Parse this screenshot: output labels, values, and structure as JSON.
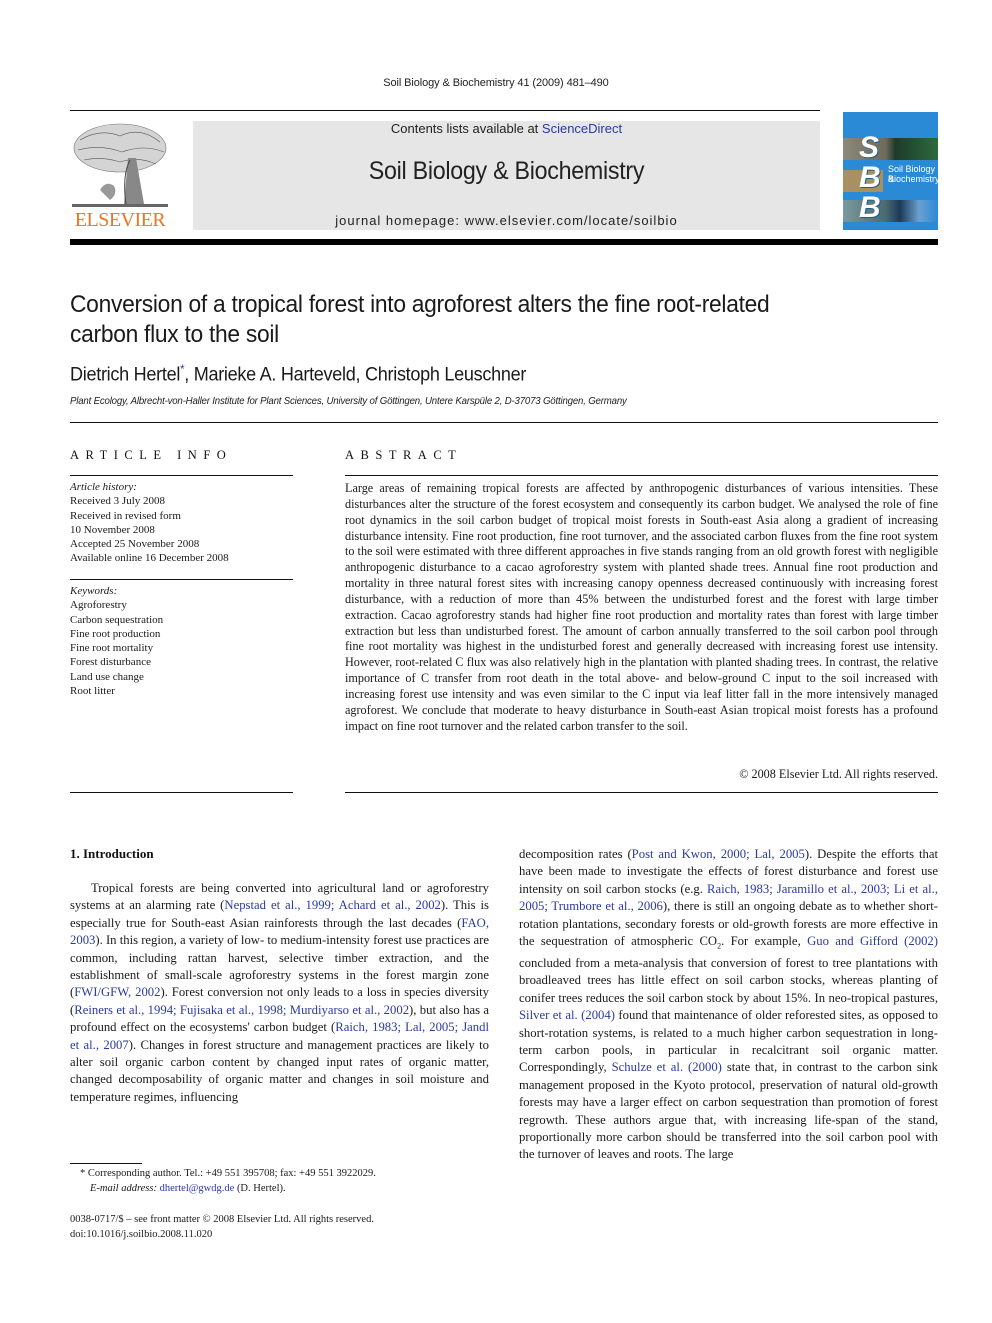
{
  "running_head": "Soil Biology & Biochemistry 41 (2009) 481–490",
  "masthead": {
    "contents_prefix": "Contents lists available at ",
    "contents_link": "ScienceDirect",
    "journal_title": "Soil Biology & Biochemistry",
    "homepage": "journal homepage: www.elsevier.com/locate/soilbio"
  },
  "publisher_logo": {
    "word": "ELSEVIER",
    "color": "#e87722"
  },
  "cover": {
    "letters": [
      "S",
      "B",
      "B"
    ],
    "text_line1": "Soil Biology &",
    "text_line2": "Biochemistry",
    "color": "#2a8ad6"
  },
  "article": {
    "title_line1": "Conversion of a tropical forest into agroforest alters the fine root-related",
    "title_line2": "carbon flux to the soil",
    "authors_first": "Dietrich Hertel",
    "authors_star": "*",
    "authors_rest": ", Marieke A. Harteveld, Christoph Leuschner",
    "affiliation": "Plant Ecology, Albrecht-von-Haller Institute for Plant Sciences, University of Göttingen, Untere Karspüle 2, D-37073 Göttingen, Germany"
  },
  "article_info": {
    "heading": "ARTICLE INFO",
    "history_label": "Article history:",
    "history": [
      "Received 3 July 2008",
      "Received in revised form",
      "10 November 2008",
      "Accepted 25 November 2008",
      "Available online 16 December 2008"
    ],
    "keywords_label": "Keywords:",
    "keywords": [
      "Agroforestry",
      "Carbon sequestration",
      "Fine root production",
      "Fine root mortality",
      "Forest disturbance",
      "Land use change",
      "Root litter"
    ]
  },
  "abstract": {
    "heading": "ABSTRACT",
    "text": "Large areas of remaining tropical forests are affected by anthropogenic disturbances of various intensities. These disturbances alter the structure of the forest ecosystem and consequently its carbon budget. We analysed the role of fine root dynamics in the soil carbon budget of tropical moist forests in South-east Asia along a gradient of increasing disturbance intensity. Fine root production, fine root turnover, and the associated carbon fluxes from the fine root system to the soil were estimated with three different approaches in five stands ranging from an old growth forest with negligible anthropogenic disturbance to a cacao agroforestry system with planted shade trees. Annual fine root production and mortality in three natural forest sites with increasing canopy openness decreased continuously with increasing forest disturbance, with a reduction of more than 45% between the undisturbed forest and the forest with large timber extraction. Cacao agroforestry stands had higher fine root production and mortality rates than forest with large timber extraction but less than undisturbed forest. The amount of carbon annually transferred to the soil carbon pool through fine root mortality was highest in the undisturbed forest and generally decreased with increasing forest use intensity. However, root-related C flux was also relatively high in the plantation with planted shading trees. In contrast, the relative importance of C transfer from root death in the total above- and below-ground C input to the soil increased with increasing forest use intensity and was even similar to the C input via leaf litter fall in the more intensively managed agroforest. We conclude that moderate to heavy disturbance in South-east Asian tropical moist forests has a profound impact on fine root turnover and the related carbon transfer to the soil.",
    "copyright": "© 2008 Elsevier Ltd. All rights reserved."
  },
  "introduction": {
    "heading": "1.  Introduction",
    "left": [
      {
        "t": "Tropical forests are being converted into agricultural land or agroforestry systems at an alarming rate ("
      },
      {
        "l": "Nepstad et al., 1999; Achard et al., 2002"
      },
      {
        "t": "). This is especially true for South-east Asian rainforests through the last decades ("
      },
      {
        "l": "FAO, 2003"
      },
      {
        "t": "). In this region, a variety of low- to medium-intensity forest use practices are common, including rattan harvest, selective timber extraction, and the establishment of small-scale agroforestry systems in the forest margin zone ("
      },
      {
        "l": "FWI/GFW, 2002"
      },
      {
        "t": "). Forest conversion not only leads to a loss in species diversity ("
      },
      {
        "l": "Reiners et al., 1994; Fujisaka et al., 1998; Murdiyarso et al., 2002"
      },
      {
        "t": "), but also has a profound effect on the ecosystems' carbon budget ("
      },
      {
        "l": "Raich, 1983; Lal, 2005; Jandl et al., 2007"
      },
      {
        "t": "). Changes in forest structure and management practices are likely to alter soil organic carbon content by changed input rates of organic matter, changed decomposability of organic matter and changes in soil moisture and temperature regimes, influencing"
      }
    ],
    "right": [
      {
        "t": "decomposition rates ("
      },
      {
        "l": "Post and Kwon, 2000; Lal, 2005"
      },
      {
        "t": "). Despite the efforts that have been made to investigate the effects of forest disturbance and forest use intensity on soil carbon stocks (e.g. "
      },
      {
        "l": "Raich, 1983; Jaramillo et al., 2003; Li et al., 2005; Trumbore et al., 2006"
      },
      {
        "t": "), there is still an ongoing debate as to whether short-rotation plantations, secondary forests or old-growth forests are more effective in the sequestration of atmospheric CO"
      },
      {
        "s": "2"
      },
      {
        "t": ". For example, "
      },
      {
        "l": "Guo and Gifford (2002)"
      },
      {
        "t": " concluded from a meta-analysis that conversion of forest to tree plantations with broadleaved trees has little effect on soil carbon stocks, whereas planting of conifer trees reduces the soil carbon stock by about 15%. In neo-tropical pastures, "
      },
      {
        "l": "Silver et al. (2004)"
      },
      {
        "t": " found that maintenance of older reforested sites, as opposed to short-rotation systems, is related to a much higher carbon sequestration in long-term carbon pools, in particular in recalcitrant soil organic matter. Correspondingly, "
      },
      {
        "l": "Schulze et al. (2000)"
      },
      {
        "t": " state that, in contrast to the carbon sink management proposed in the Kyoto protocol, preservation of natural old-growth forests may have a larger effect on carbon sequestration than promotion of forest regrowth. These authors argue that, with increasing life-span of the stand, proportionally more carbon should be transferred into the soil carbon pool with the turnover of leaves and roots. The large"
      }
    ]
  },
  "footnote": {
    "star": "*",
    "corresponding": " Corresponding author. Tel.: +49 551 395708; fax: +49 551 3922029.",
    "email_label": "E-mail address:",
    "email": "dhertel@gwdg.de",
    "email_suffix": " (D. Hertel)."
  },
  "front_matter": {
    "line1": "0038-0717/$ – see front matter © 2008 Elsevier Ltd. All rights reserved.",
    "doi": "doi:10.1016/j.soilbio.2008.11.020"
  },
  "colors": {
    "link": "#2a3aa0",
    "masthead_bg": "#e6e6e6"
  }
}
